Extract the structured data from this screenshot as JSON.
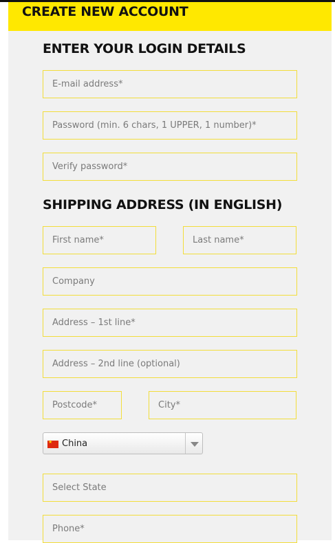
{
  "header": {
    "title": "CREATE NEW ACCOUNT"
  },
  "login": {
    "section_title": "ENTER YOUR LOGIN DETAILS",
    "email_placeholder": "E-mail address*",
    "password_placeholder": "Password (min. 6 chars, 1 UPPER, 1 number)*",
    "verify_placeholder": "Verify password*"
  },
  "shipping": {
    "section_title": "SHIPPING ADDRESS (IN ENGLISH)",
    "first_name_placeholder": "First name*",
    "last_name_placeholder": "Last name*",
    "company_placeholder": "Company",
    "address1_placeholder": "Address – 1st line*",
    "address2_placeholder": "Address – 2nd line (optional)",
    "postcode_placeholder": "Postcode*",
    "city_placeholder": "City*",
    "country": {
      "selected": "China",
      "flag_icon": "china-flag-icon"
    },
    "state_placeholder": "Select State",
    "phone_placeholder": "Phone*"
  },
  "colors": {
    "header_bg": "#ffe800",
    "field_border": "#f2dd3a",
    "panel_bg": "#f1f1f1"
  }
}
